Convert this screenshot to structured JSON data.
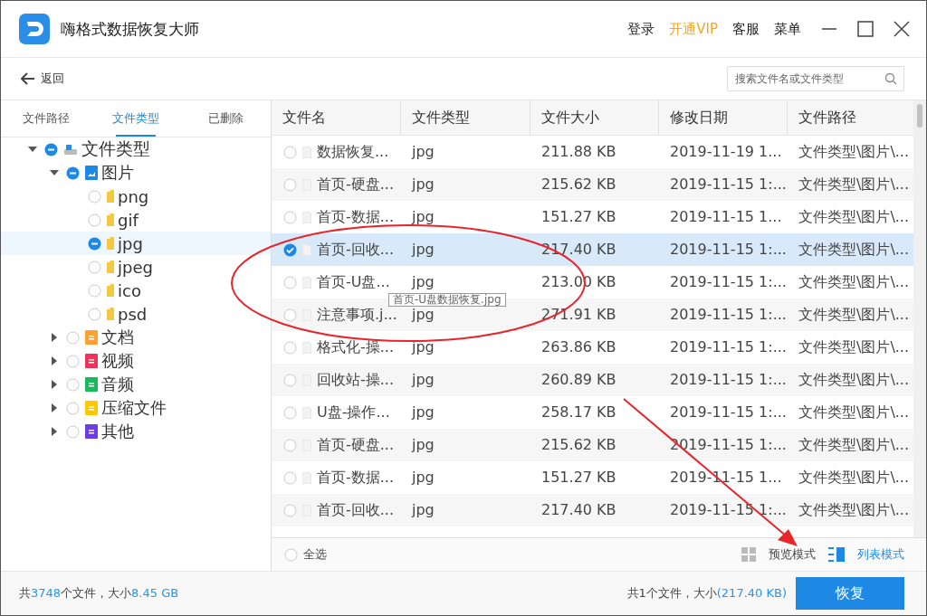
{
  "window": {
    "title": "嗨格式数据恢复大师",
    "menu": [
      {
        "label": "登录",
        "highlight": false
      },
      {
        "label": "开通VIP",
        "highlight": true
      },
      {
        "label": "客服",
        "highlight": false
      },
      {
        "label": "菜单",
        "highlight": false
      }
    ]
  },
  "toolbar": {
    "back": "返回",
    "search": {
      "placeholder": "搜索文件名或文件类型"
    }
  },
  "tabs": [
    {
      "label": "文件路径",
      "selected": false
    },
    {
      "label": "文件类型",
      "selected": true
    },
    {
      "label": "已删除",
      "selected": false
    }
  ],
  "tree": [
    {
      "label": "文件类型",
      "kind": "drive",
      "partial": true,
      "expanded": true,
      "selected": false,
      "children": [
        {
          "label": "图片",
          "kind": "image",
          "partial": true,
          "expanded": true,
          "selected": false,
          "children": [
            {
              "label": "png",
              "kind": "folder",
              "partial": false,
              "selected": false
            },
            {
              "label": "gif",
              "kind": "folder",
              "partial": false,
              "selected": false
            },
            {
              "label": "jpg",
              "kind": "folder",
              "partial": true,
              "selected": true
            },
            {
              "label": "jpeg",
              "kind": "folder",
              "partial": false,
              "selected": false
            },
            {
              "label": "ico",
              "kind": "folder",
              "partial": false,
              "selected": false
            },
            {
              "label": "psd",
              "kind": "folder",
              "partial": false,
              "selected": false
            }
          ]
        },
        {
          "label": "文档",
          "kind": "document",
          "partial": false,
          "expanded": false,
          "selected": false,
          "color": "#ffa033"
        },
        {
          "label": "视频",
          "kind": "video",
          "partial": false,
          "expanded": false,
          "selected": false,
          "color": "#f0325a"
        },
        {
          "label": "音频",
          "kind": "audio",
          "partial": false,
          "expanded": false,
          "selected": false,
          "color": "#19b95a"
        },
        {
          "label": "压缩文件",
          "kind": "archive",
          "partial": false,
          "expanded": false,
          "selected": false,
          "color": "#ffc800"
        },
        {
          "label": "其他",
          "kind": "other",
          "partial": false,
          "expanded": false,
          "selected": false,
          "color": "#6e3ce6"
        }
      ]
    }
  ],
  "table": {
    "columns": [
      "文件名",
      "文件类型",
      "文件大小",
      "修改日期",
      "文件路径"
    ],
    "rows": [
      {
        "name": "数据恢复...",
        "type": "jpg",
        "size": "211.88 KB",
        "date": "2019-11-19 1...",
        "path": "文件类型\\图片\\...",
        "checked": false
      },
      {
        "name": "首页-硬盘...",
        "type": "jpg",
        "size": "215.62 KB",
        "date": "2019-11-15 1:...",
        "path": "文件类型\\图片\\...",
        "checked": false
      },
      {
        "name": "首页-数据...",
        "type": "jpg",
        "size": "151.27 KB",
        "date": "2019-11-15 1...",
        "path": "文件类型\\图片\\...",
        "checked": false
      },
      {
        "name": "首页-回收...",
        "type": "jpg",
        "size": "217.40 KB",
        "date": "2019-11-15 1:...",
        "path": "文件类型\\图片\\...",
        "checked": true
      },
      {
        "name": "首页-U盘...",
        "type": "jpg",
        "size": "213.00 KB",
        "date": "2019-11-15 1:...",
        "path": "文件类型\\图片\\...",
        "checked": false
      },
      {
        "name": "注意事项.j...",
        "type": "jpg",
        "size": "271.91 KB",
        "date": "2019-11-15 1:...",
        "path": "文件类型\\图片\\...",
        "checked": false
      },
      {
        "name": "格式化-操...",
        "type": "jpg",
        "size": "263.86 KB",
        "date": "2019-11-15 1:...",
        "path": "文件类型\\图片\\...",
        "checked": false
      },
      {
        "name": "回收站-操...",
        "type": "jpg",
        "size": "260.89 KB",
        "date": "2019-11-15 1:...",
        "path": "文件类型\\图片\\...",
        "checked": false
      },
      {
        "name": "U盘-操作...",
        "type": "jpg",
        "size": "258.17 KB",
        "date": "2019-11-15 1:...",
        "path": "文件类型\\图片\\...",
        "checked": false
      },
      {
        "name": "首页-硬盘...",
        "type": "jpg",
        "size": "215.62 KB",
        "date": "2019-11-15 1:...",
        "path": "文件类型\\图片\\...",
        "checked": false
      },
      {
        "name": "首页-数据...",
        "type": "jpg",
        "size": "151.27 KB",
        "date": "2019-11-15 1...",
        "path": "文件类型\\图片\\...",
        "checked": false
      },
      {
        "name": "首页-回收...",
        "type": "jpg",
        "size": "217.40 KB",
        "date": "2019-11-15 1:...",
        "path": "文件类型\\图片\\...",
        "checked": false
      }
    ],
    "tooltip": "首页-U盘数据恢复.jpg"
  },
  "footer": {
    "select_all": {
      "label": "全选",
      "checked": false
    },
    "modes": [
      {
        "label": "预览模式",
        "kind": "grid",
        "selected": false
      },
      {
        "label": "列表模式",
        "kind": "list",
        "selected": true
      }
    ]
  },
  "status_bar": {
    "total_prefix": "共",
    "total_count": "3748",
    "total_mid": "个文件，大小",
    "total_size": "8.45 GB",
    "selected_text": "共1个文件，大小",
    "selected_size": "(217.40 KB)",
    "recover": "恢复"
  }
}
